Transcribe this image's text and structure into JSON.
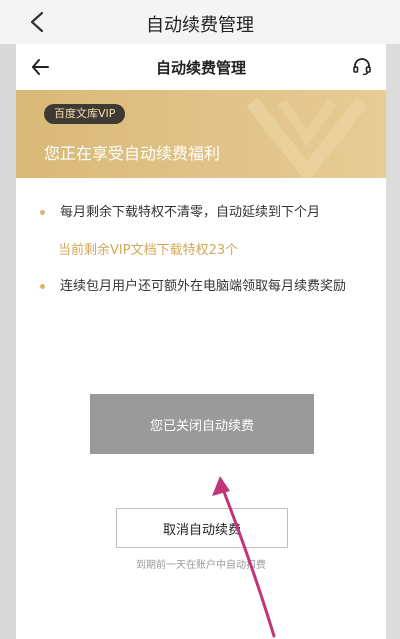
{
  "outer": {
    "title": "自动续费管理"
  },
  "nav": {
    "title": "自动续费管理"
  },
  "banner": {
    "badge": "百度文库VIP",
    "text": "您正在享受自动续费福利"
  },
  "benefits": [
    {
      "text": "每月剩余下载特权不清零，自动延续到下个月",
      "note": "当前剩余VIP文档下载特权23个"
    },
    {
      "text": "连续包月用户还可额外在电脑端领取每月续费奖励"
    }
  ],
  "status": {
    "label": "您已关闭自动续费"
  },
  "cancel": {
    "label": "取消自动续费",
    "note": "到期前一天在账户中自动扣费"
  },
  "colors": {
    "gold": "#d9b977",
    "accent_text": "#d0a95b",
    "badge_bg": "#3e3a33",
    "disabled_gray": "#9a9a9a",
    "annotation_arrow": "#c2357a"
  }
}
